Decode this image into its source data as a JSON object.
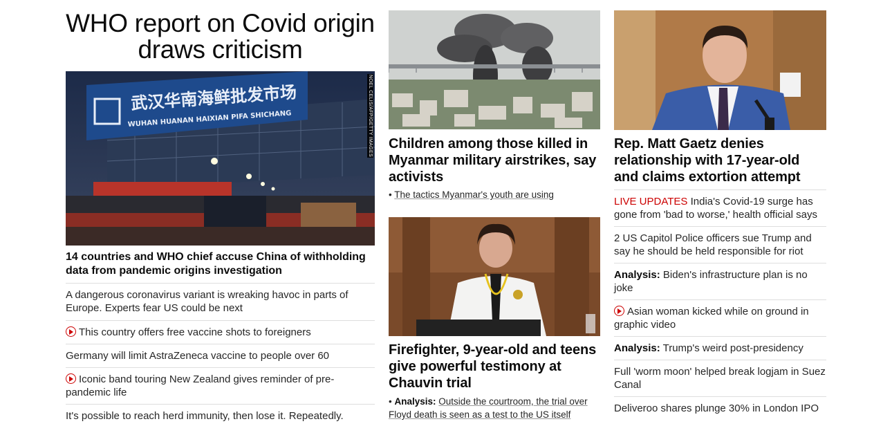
{
  "left": {
    "title": "WHO report on Covid origin draws criticism",
    "image": {
      "sign_chinese": "武汉华南海鲜批发市场",
      "sign_english": "WUHAN HUANAN HAIXIAN PIFA SHICHANG",
      "credit": "NOEL CELIS/AFP/GETTY IMAGES"
    },
    "headline": "14 countries and WHO chief accuse China of withholding data from pandemic origins investigation",
    "items": [
      {
        "text": "A dangerous coronavirus variant is wreaking havoc in parts of Europe. Experts fear US could be next"
      },
      {
        "video": true,
        "text": "This country offers free vaccine shots to foreigners"
      },
      {
        "text": "Germany will limit AstraZeneca vaccine to people over 60"
      },
      {
        "video": true,
        "text": "Iconic band touring New Zealand gives reminder of pre-pandemic life"
      },
      {
        "text": "It's possible to reach herd immunity, then lose it. Repeatedly."
      }
    ]
  },
  "middle": {
    "story1": {
      "headline": "Children among those killed in Myanmar military airstrikes, say activists",
      "sub_bullet": "•",
      "sub_text": "The tactics Myanmar's youth are using"
    },
    "story2": {
      "headline": "Firefighter, 9-year-old and teens give powerful testimony at Chauvin trial",
      "sub_bullet": "•",
      "sub_prefix": "Analysis:",
      "sub_text": "Outside the courtroom, the trial over Floyd death is seen as a test to the US itself"
    }
  },
  "right": {
    "headline": "Rep. Matt Gaetz denies relationship with 17-year-old and claims extortion attempt",
    "items": [
      {
        "live": "LIVE UPDATES",
        "text": "India's Covid-19 surge has gone from 'bad to worse,' health official says"
      },
      {
        "text": "2 US Capitol Police officers sue Trump and say he should be held responsible for riot"
      },
      {
        "prefix": "Analysis:",
        "text": "Biden's infrastructure plan is no joke"
      },
      {
        "video": true,
        "text": "Asian woman kicked while on ground in graphic video"
      },
      {
        "prefix": "Analysis:",
        "text": "Trump's weird post-presidency"
      },
      {
        "text": "Full 'worm moon' helped break logjam in Suez Canal"
      },
      {
        "text": "Deliveroo shares plunge 30% in London IPO"
      }
    ]
  },
  "colors": {
    "accent_red": "#cc0000",
    "divider": "#dedede",
    "text": "#262626"
  }
}
